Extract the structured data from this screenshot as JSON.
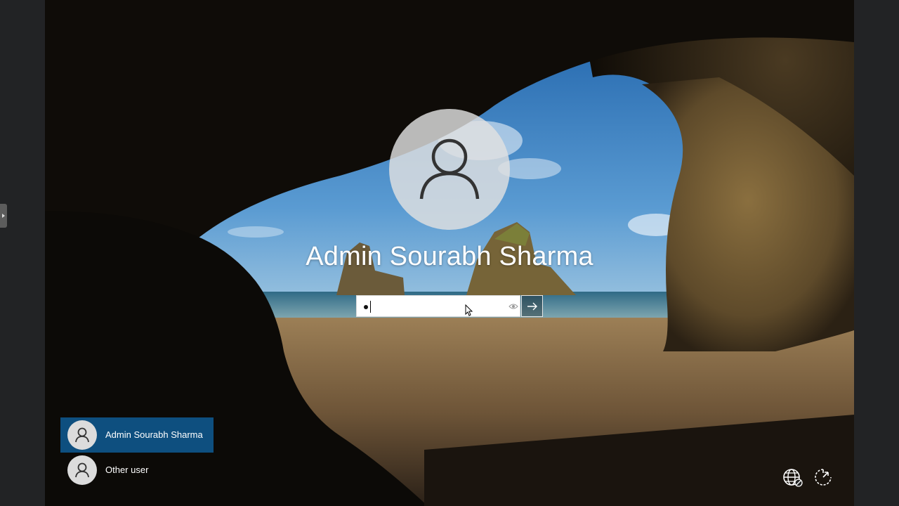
{
  "login": {
    "user_name": "Admin Sourabh Sharma",
    "password_value": "•"
  },
  "user_list": {
    "items": [
      {
        "label": "Admin Sourabh Sharma",
        "selected": true
      },
      {
        "label": "Other user",
        "selected": false
      }
    ]
  },
  "corner_icons": {
    "network": "network-icon",
    "accessibility": "ease-of-access-icon"
  },
  "colors": {
    "selected_tile": "#0e4f7f",
    "avatar_bg": "#e1e1e1",
    "text": "#ffffff"
  }
}
